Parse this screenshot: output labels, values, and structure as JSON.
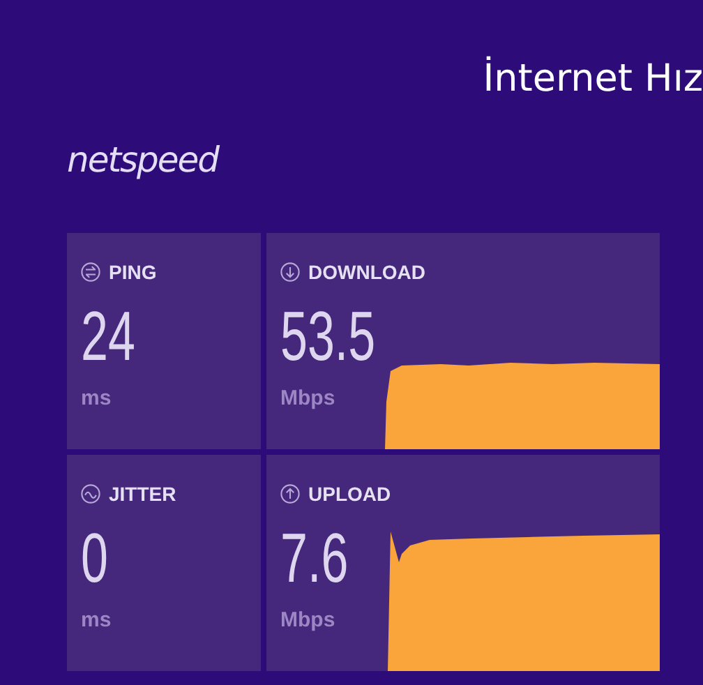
{
  "title": "İnternet Hız",
  "logo": "netspeed",
  "metrics": [
    {
      "kind": "ping",
      "label": "PING",
      "value": "24",
      "unit": "ms"
    },
    {
      "kind": "download",
      "label": "DOWNLOAD",
      "value": "53.5",
      "unit": "Mbps"
    },
    {
      "kind": "jitter",
      "label": "JITTER",
      "value": "0",
      "unit": "ms"
    },
    {
      "kind": "upload",
      "label": "UPLOAD",
      "value": "7.6",
      "unit": "Mbps"
    }
  ]
}
